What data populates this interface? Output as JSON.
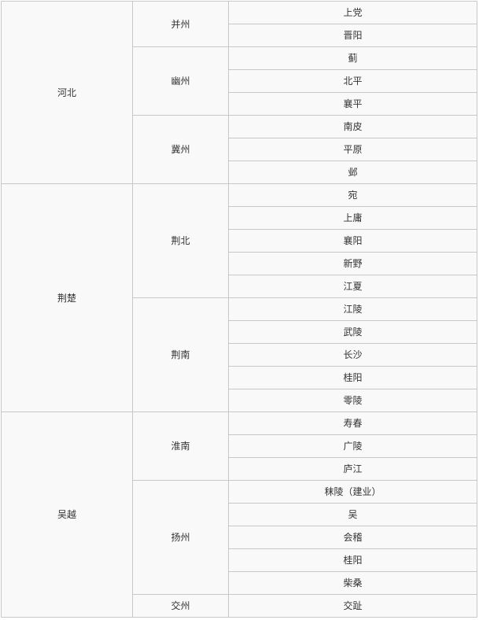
{
  "table": {
    "regions": [
      {
        "name": "河北",
        "provinces": [
          {
            "name": "并州",
            "cities": [
              "上党",
              "晋阳"
            ]
          },
          {
            "name": "幽州",
            "cities": [
              "蓟",
              "北平",
              "襄平"
            ]
          },
          {
            "name": "冀州",
            "cities": [
              "南皮",
              "平原",
              "邺"
            ]
          }
        ]
      },
      {
        "name": "荆楚",
        "provinces": [
          {
            "name": "荆北",
            "cities": [
              "宛",
              "上庸",
              "襄阳",
              "新野",
              "江夏"
            ]
          },
          {
            "name": "荆南",
            "cities": [
              "江陵",
              "武陵",
              "长沙",
              "桂阳",
              "零陵"
            ]
          }
        ]
      },
      {
        "name": "吴越",
        "provinces": [
          {
            "name": "淮南",
            "cities": [
              "寿春",
              "广陵",
              "庐江"
            ]
          },
          {
            "name": "扬州",
            "cities": [
              "秣陵（建业）",
              "吴",
              "会稽",
              "桂阳",
              "柴桑"
            ]
          },
          {
            "name": "交州",
            "cities": [
              "交趾"
            ]
          }
        ]
      }
    ]
  },
  "colors": {
    "cell_background": "#f9f9f9",
    "border": "#c8c8c8",
    "text": "#333333"
  }
}
